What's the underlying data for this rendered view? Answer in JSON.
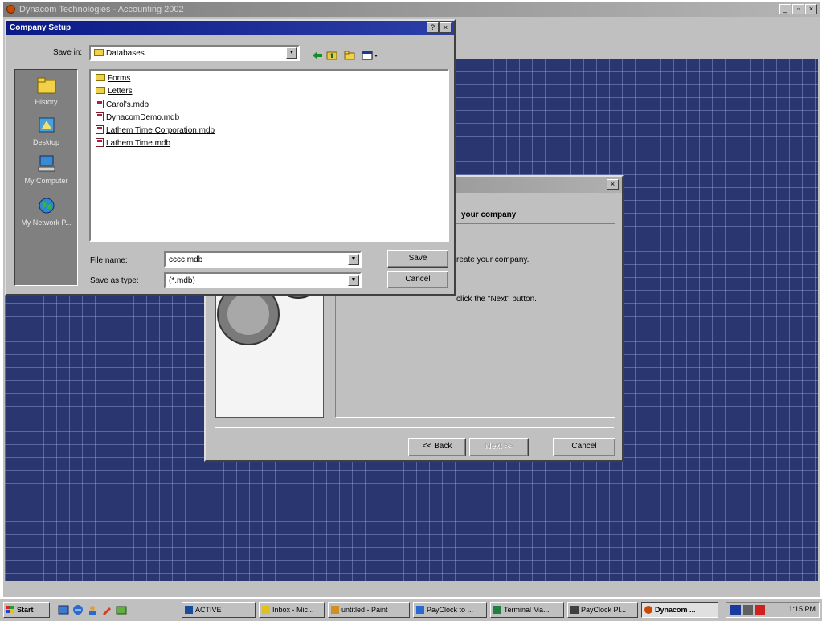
{
  "app": {
    "title": "Dynacom Technologies - Accounting 2002"
  },
  "wizard": {
    "heading": "your company",
    "text1": "reate your company.",
    "text2": "click the \"Next\" button.",
    "back_label": "<< Back",
    "next_label": "Next >>",
    "cancel_label": "Cancel"
  },
  "dialog": {
    "title": "Company Setup",
    "save_in_label": "Save in:",
    "save_in_value": "Databases",
    "places": [
      "History",
      "Desktop",
      "My Computer",
      "My Network P..."
    ],
    "files": [
      {
        "name": "Forms",
        "kind": "folder"
      },
      {
        "name": "Letters",
        "kind": "folder"
      },
      {
        "name": "Carol's.mdb",
        "kind": "mdb"
      },
      {
        "name": "DynacomDemo.mdb",
        "kind": "mdb"
      },
      {
        "name": "Lathem Time Corporation.mdb",
        "kind": "mdb"
      },
      {
        "name": "Lathem Time.mdb",
        "kind": "mdb"
      }
    ],
    "filename_label": "File name:",
    "filename_value": "cccc.mdb",
    "savetype_label": "Save as type:",
    "savetype_value": "(*.mdb)",
    "save_label": "Save",
    "cancel_label": "Cancel"
  },
  "taskbar": {
    "start_label": "Start",
    "items": [
      {
        "label": "ACTIVE"
      },
      {
        "label": "Inbox - Mic..."
      },
      {
        "label": "untitled - Paint"
      },
      {
        "label": "PayClock to ..."
      },
      {
        "label": "Terminal Ma..."
      },
      {
        "label": "PayClock Pl..."
      },
      {
        "label": "Dynacom ..."
      }
    ],
    "clock": "1:15 PM"
  }
}
